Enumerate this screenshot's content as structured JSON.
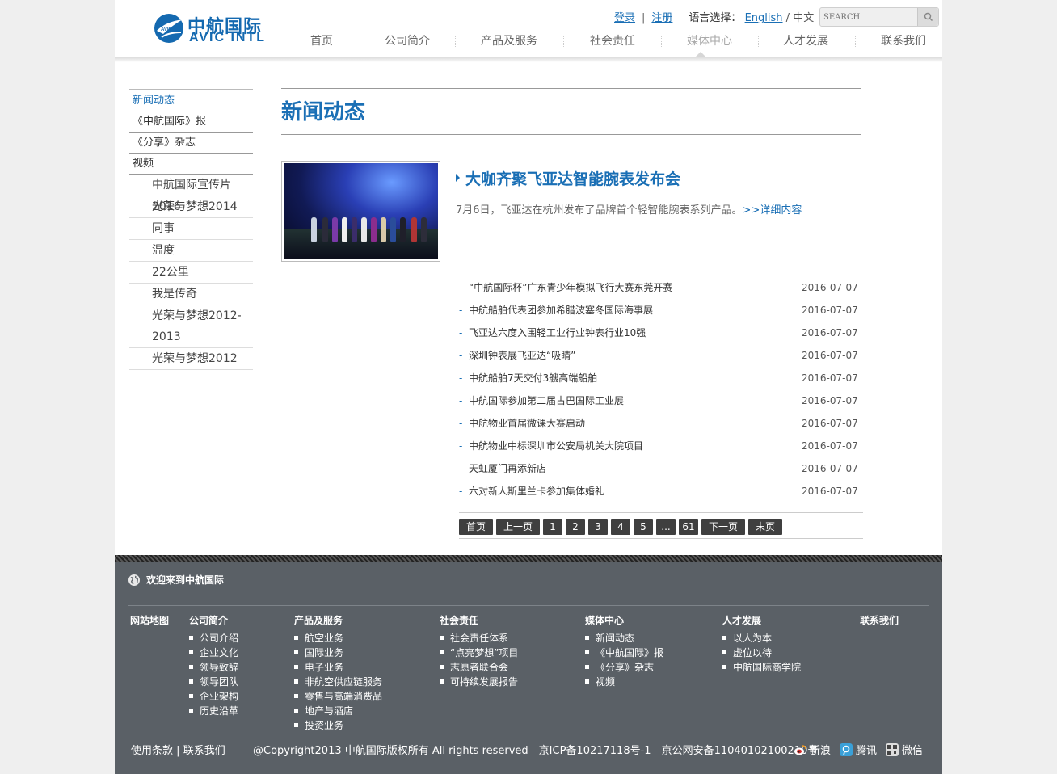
{
  "header": {
    "logo_cn": "中航国际",
    "logo_en": "AVIC INTL",
    "login": "登录",
    "register": "注册",
    "lang_label": "语言选择：",
    "lang_en": "English",
    "lang_sep": "/",
    "lang_cn": "中文",
    "search_placeholder": "SEARCH"
  },
  "nav": {
    "items": [
      {
        "label": "首页"
      },
      {
        "label": "公司简介"
      },
      {
        "label": "产品及服务"
      },
      {
        "label": "社会责任"
      },
      {
        "label": "媒体中心"
      },
      {
        "label": "人才发展"
      },
      {
        "label": "联系我们"
      }
    ],
    "active": "媒体中心"
  },
  "sidebar": {
    "items": [
      {
        "label": "新闻动态"
      },
      {
        "label": "《中航国际》报"
      },
      {
        "label": "《分享》杂志"
      },
      {
        "label": "视频"
      }
    ],
    "sub_items": [
      {
        "label": "中航国际宣传片2016"
      },
      {
        "label": "光荣与梦想2014"
      },
      {
        "label": "同事"
      },
      {
        "label": "温度"
      },
      {
        "label": "22公里"
      },
      {
        "label": "我是传奇"
      },
      {
        "label": "光荣与梦想2012-2013"
      },
      {
        "label": "光荣与梦想2012"
      }
    ]
  },
  "main": {
    "title": "新闻动态",
    "featured": {
      "title": "大咖齐聚飞亚达智能腕表发布会",
      "desc": "7月6日，飞亚达在杭州发布了品牌首个轻智能腕表系列产品。",
      "more": ">>详细内容"
    },
    "news": [
      {
        "title": "“中航国际杯”广东青少年模拟飞行大赛东莞开赛",
        "date": "2016-07-07"
      },
      {
        "title": "中航船舶代表团参加希腊波塞冬国际海事展",
        "date": "2016-07-07"
      },
      {
        "title": "飞亚达六度入围轻工业行业钟表行业10强",
        "date": "2016-07-07"
      },
      {
        "title": "深圳钟表展飞亚达“吸睛”",
        "date": "2016-07-07"
      },
      {
        "title": "中航船舶7天交付3艘高端船舶",
        "date": "2016-07-07"
      },
      {
        "title": "中航国际参加第二届古巴国际工业展",
        "date": "2016-07-07"
      },
      {
        "title": "中航物业首届微课大赛启动",
        "date": "2016-07-07"
      },
      {
        "title": "中航物业中标深圳市公安局机关大院项目",
        "date": "2016-07-07"
      },
      {
        "title": "天虹厦门再添新店",
        "date": "2016-07-07"
      },
      {
        "title": "六对新人斯里兰卡参加集体婚礼",
        "date": "2016-07-07"
      }
    ],
    "pager": [
      "首页",
      "上一页",
      "1",
      "2",
      "3",
      "4",
      "5",
      "...",
      "61",
      "下一页",
      "末页"
    ]
  },
  "footer": {
    "welcome": "欢迎来到中航国际",
    "sitemap": "网站地图",
    "columns": [
      {
        "head": "公司简介",
        "items": [
          "公司介绍",
          "企业文化",
          "领导致辞",
          "领导团队",
          "企业架构",
          "历史沿革"
        ]
      },
      {
        "head": "产品及服务",
        "items": [
          "航空业务",
          "国际业务",
          "电子业务",
          "非航空供应链服务",
          "零售与高端消费品",
          "地产与酒店",
          "投资业务"
        ]
      },
      {
        "head": "社会责任",
        "items": [
          "社会责任体系",
          "“点亮梦想”项目",
          "志愿者联合会",
          "可持续发展报告"
        ]
      },
      {
        "head": "媒体中心",
        "items": [
          "新闻动态",
          "《中航国际》报",
          "《分享》杂志",
          "视频"
        ]
      },
      {
        "head": "人才发展",
        "items": [
          "以人为本",
          "虚位以待",
          "中航国际商学院"
        ]
      },
      {
        "head": "联系我们",
        "items": []
      }
    ],
    "terms": "使用条款",
    "bar": "|",
    "contact": "联系我们",
    "copyright": "@Copyright2013 中航国际版权所有 All rights reserved　京ICP备10217118号-1　京公网安备11040102100210号",
    "social": [
      {
        "label": "新浪",
        "icon": "weibo-icon",
        "color": "#d52c2b"
      },
      {
        "label": "腾讯",
        "icon": "tencent-weibo-icon",
        "color": "#3aa0d8"
      },
      {
        "label": "微信",
        "icon": "wechat-qr-icon",
        "color": "#dddddd"
      }
    ]
  },
  "colors": {
    "brand_blue": "#1a6fb5",
    "footer_bg": "#5a6066",
    "pager_bg": "#3f3f3f"
  }
}
